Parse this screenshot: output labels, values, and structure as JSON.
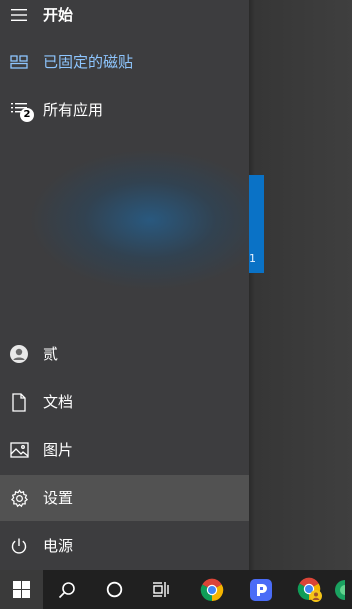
{
  "start_menu": {
    "header_label": "开始",
    "pinned_tiles_label": "已固定的磁贴",
    "all_apps_label": "所有应用",
    "all_apps_badge": "2",
    "user_label": "贰",
    "documents_label": "文档",
    "pictures_label": "图片",
    "settings_label": "设置",
    "power_label": "电源"
  },
  "tile": {
    "glyph": "1"
  },
  "taskbar": {
    "icons": [
      "windows-start-icon",
      "search-icon",
      "cortana-circle-icon",
      "task-view-icon",
      "chrome-icon",
      "blue-app-icon",
      "chrome-badged-icon",
      "green-app-icon"
    ]
  },
  "colors": {
    "accent_blue": "#0a72c6",
    "pinned_text": "#8ec6ff",
    "highlight_row": "#525252",
    "taskbar": "#202020"
  }
}
